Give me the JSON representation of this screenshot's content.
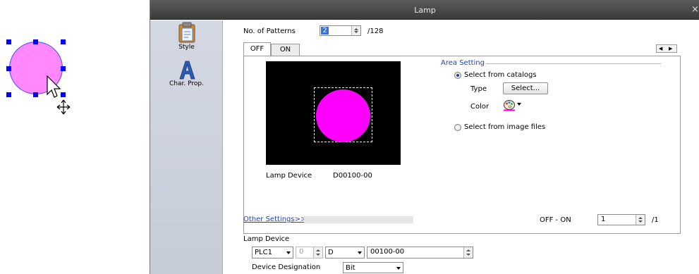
{
  "dialog": {
    "title": "Lamp"
  },
  "sidebar": {
    "items": [
      {
        "label": "Style",
        "icon": "clipboard-icon"
      },
      {
        "label": "Char. Prop.",
        "icon": "letter-a-icon"
      }
    ]
  },
  "patterns": {
    "label": "No. of Patterns",
    "value": "2",
    "max": "/128"
  },
  "tabs": [
    "OFF",
    "ON"
  ],
  "area_setting": {
    "title": "Area Setting",
    "catalog_option": "Select from catalogs",
    "type_label": "Type",
    "select_button": "Select...",
    "color_label": "Color",
    "image_option": "Select from image files",
    "selected": "catalogs"
  },
  "preview": {
    "lamp_device_label": "Lamp Device",
    "lamp_device_value": "D00100-00",
    "shape_color": "#ff00ff"
  },
  "other_settings": {
    "link": "Other Settings>>",
    "off_on_label": "OFF - ON",
    "off_on_value": "1",
    "off_on_max": "/1"
  },
  "lamp_device": {
    "section_label": "Lamp Device",
    "plc": "PLC1",
    "station": "0",
    "device_type": "D",
    "address": "00100-00",
    "designation_label": "Device Designation",
    "designation_value": "Bit"
  },
  "canvas": {
    "shape_color": "#ff88ff",
    "handle_color": "#0000ff"
  }
}
